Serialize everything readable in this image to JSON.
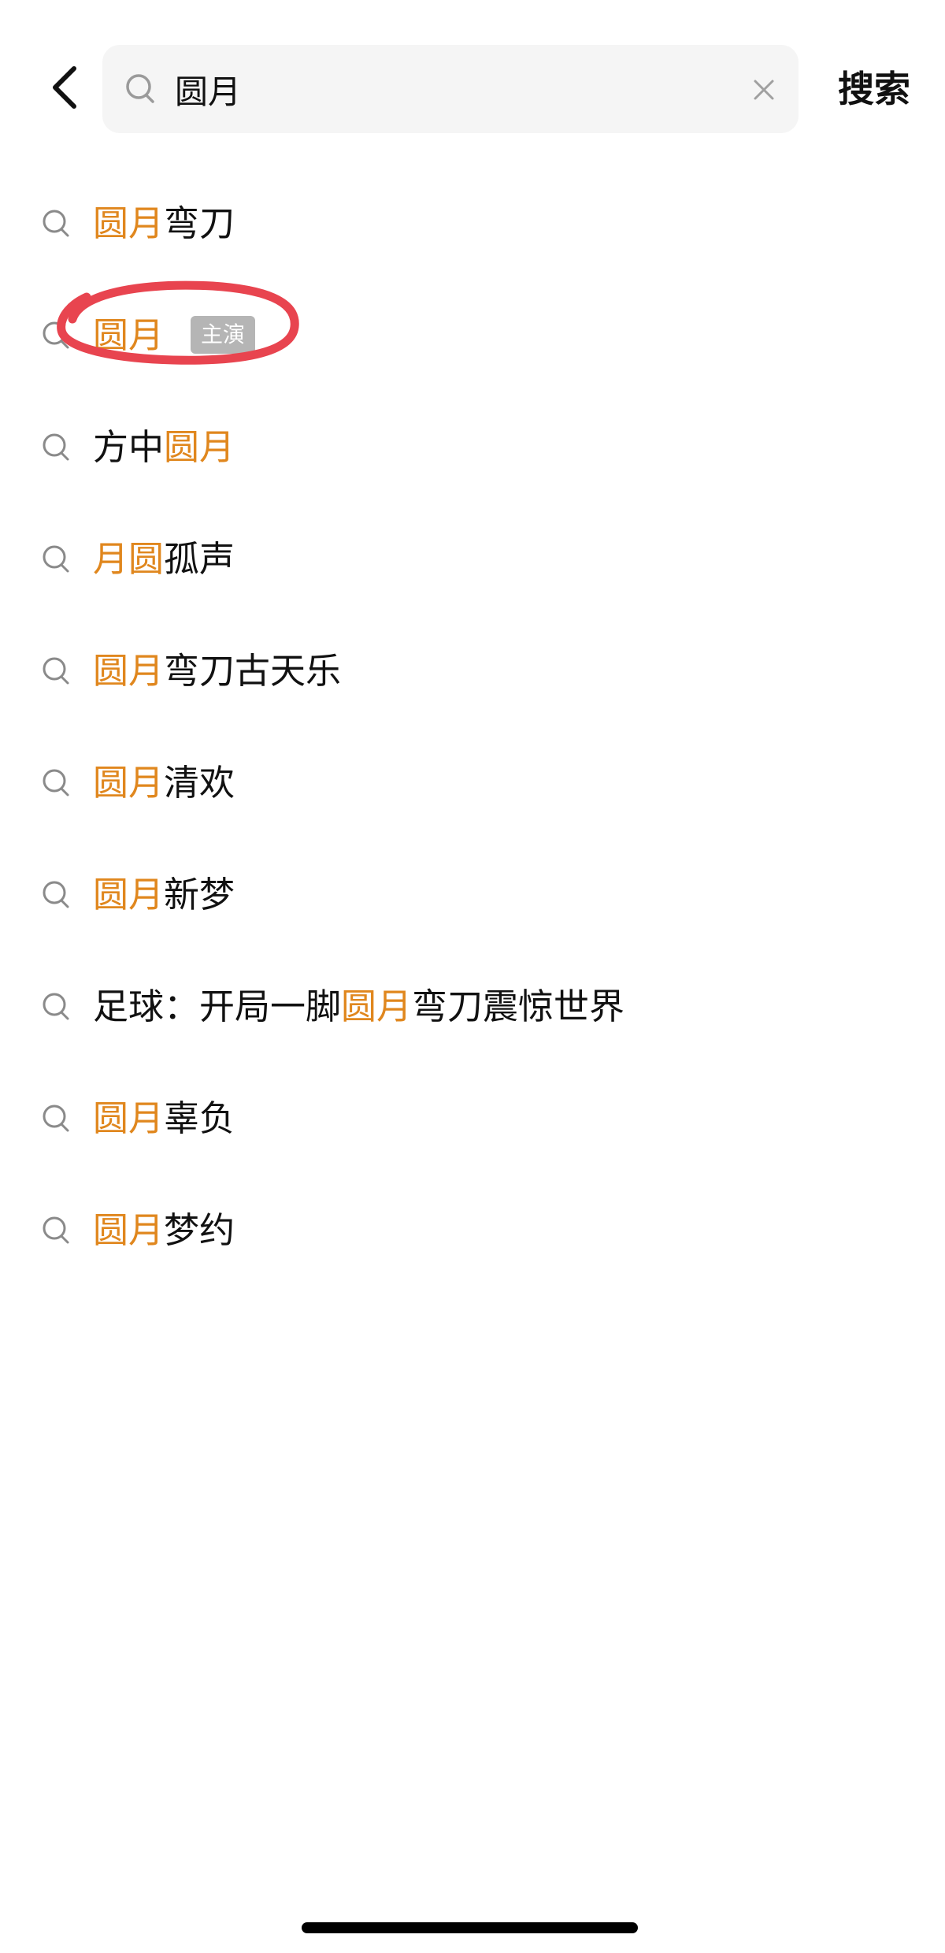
{
  "search": {
    "value": "圆月",
    "placeholder": "",
    "submit_label": "搜索"
  },
  "icons": {
    "back": "back-chevron-icon",
    "search": "search-icon",
    "clear": "close-icon",
    "row": "search-icon"
  },
  "colors": {
    "highlight": "#e0871e",
    "tag_bg": "#b5b5b5",
    "search_bg": "#f5f5f5",
    "annotation": "#e8444f"
  },
  "suggestions": [
    {
      "parts": [
        {
          "text": "圆月",
          "hl": true
        },
        {
          "text": "弯刀",
          "hl": false
        }
      ],
      "tag": ""
    },
    {
      "parts": [
        {
          "text": "圆月",
          "hl": true
        }
      ],
      "tag": "主演"
    },
    {
      "parts": [
        {
          "text": "方中",
          "hl": false
        },
        {
          "text": "圆月",
          "hl": true
        }
      ],
      "tag": ""
    },
    {
      "parts": [
        {
          "text": "月圆",
          "hl": true
        },
        {
          "text": "孤声",
          "hl": false
        }
      ],
      "tag": ""
    },
    {
      "parts": [
        {
          "text": "圆月",
          "hl": true
        },
        {
          "text": "弯刀古天乐",
          "hl": false
        }
      ],
      "tag": ""
    },
    {
      "parts": [
        {
          "text": "圆月",
          "hl": true
        },
        {
          "text": "清欢",
          "hl": false
        }
      ],
      "tag": ""
    },
    {
      "parts": [
        {
          "text": "圆月",
          "hl": true
        },
        {
          "text": "新梦",
          "hl": false
        }
      ],
      "tag": ""
    },
    {
      "parts": [
        {
          "text": "足球：开局一脚",
          "hl": false
        },
        {
          "text": "圆月",
          "hl": true
        },
        {
          "text": "弯刀震惊世界",
          "hl": false
        }
      ],
      "tag": ""
    },
    {
      "parts": [
        {
          "text": "圆月",
          "hl": true
        },
        {
          "text": "辜负",
          "hl": false
        }
      ],
      "tag": ""
    },
    {
      "parts": [
        {
          "text": "圆月",
          "hl": true
        },
        {
          "text": "梦约",
          "hl": false
        }
      ],
      "tag": ""
    }
  ]
}
